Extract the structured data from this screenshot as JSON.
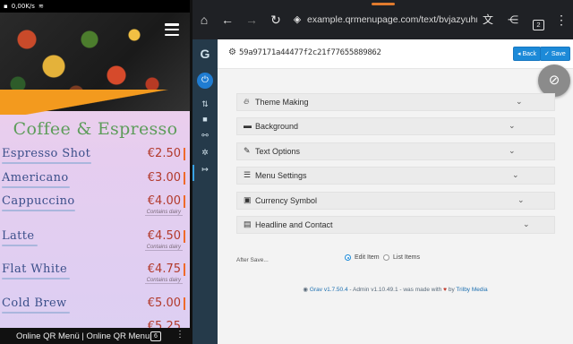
{
  "status_bar": {
    "time": "",
    "net_speed": "0,00K/s"
  },
  "menu_preview": {
    "category_title": "Coffee & Espresso",
    "items": [
      {
        "name": "Espresso Shot",
        "price": "€2.50",
        "tag": ""
      },
      {
        "name": "Americano",
        "price": "€3.00",
        "tag": ""
      },
      {
        "name": "Cappuccino",
        "price": "€4.00",
        "tag": "Contains dairy"
      },
      {
        "name": "Latte",
        "price": "€4.50",
        "tag": "Contains dairy"
      },
      {
        "name": "Flat White",
        "price": "€4.75",
        "tag": "Contains dairy"
      },
      {
        "name": "Cold Brew",
        "price": "€5.00",
        "tag": ""
      },
      {
        "name": "",
        "price": "€5.25",
        "tag": ""
      }
    ],
    "bottom_bar_title": "Online QR Menü | Online QR Menu",
    "tab_count": "6",
    "colors": {
      "title": "#5d9c5a",
      "item": "#3b4f8a",
      "price": "#b23a2c",
      "accent": "#ef6a2a"
    }
  },
  "browser": {
    "url": "example.qrmenupage.com/text/bvjazyuhmcsdnq",
    "tab_count": "2",
    "icons": [
      "home-icon",
      "back-arrow-icon",
      "forward-arrow-icon",
      "reload-icon",
      "secure-site-icon",
      "translate-icon",
      "share-icon",
      "tabs-icon",
      "more-vert-icon"
    ]
  },
  "admin": {
    "sidebar_icons": [
      "grav-logo-icon",
      "power-icon",
      "refresh-icon",
      "pages-icon",
      "plugins-icon",
      "settings-icon",
      "logout-icon"
    ],
    "page_id": "59a97171a44477f2c21f77655889862",
    "back_label": "Back",
    "save_label": "Save",
    "sections": [
      {
        "label": "Theme Making",
        "icon": "fire-icon"
      },
      {
        "label": "Background",
        "icon": "image-icon"
      },
      {
        "label": "Text Options",
        "icon": "edit-icon"
      },
      {
        "label": "Menu Settings",
        "icon": "list-icon"
      },
      {
        "label": "Currency Symbol",
        "icon": "money-icon"
      },
      {
        "label": "Headline and Contact",
        "icon": "address-card-icon"
      }
    ],
    "after_save_label": "After Save...",
    "after_save_options": [
      {
        "label": "Edit Item",
        "selected": true
      },
      {
        "label": "List Items",
        "selected": false
      }
    ],
    "footer": {
      "grav": "Grav",
      "grav_version": "v1.7.50.4",
      "admin_text": "- Admin v1.10.49.1 - was made with",
      "by_text": "by",
      "trilby": "Trilby Media"
    }
  }
}
